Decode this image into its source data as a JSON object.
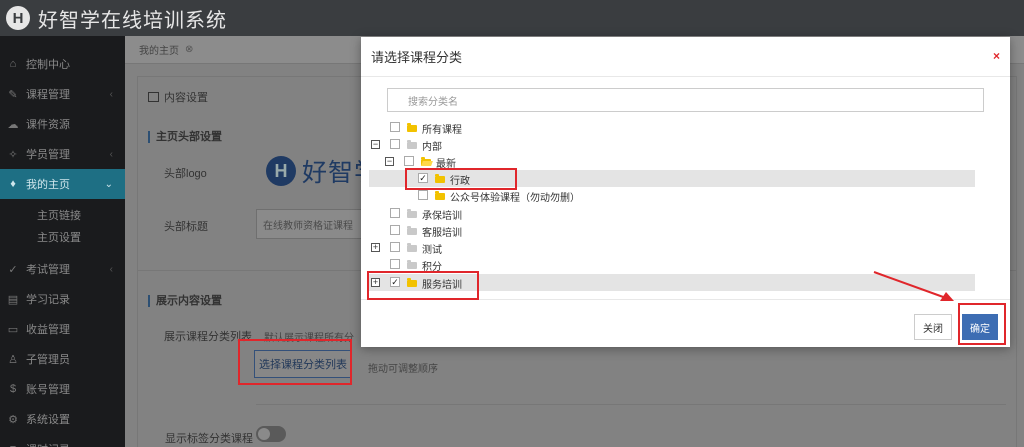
{
  "app": {
    "logo_letter": "H",
    "title": "好智学在线培训系统"
  },
  "sidebar": {
    "items": [
      {
        "icon": "home-icon",
        "glyph": "⌂",
        "label": "控制中心",
        "active": false,
        "chev": ""
      },
      {
        "icon": "course-icon",
        "glyph": "✎",
        "label": "课程管理",
        "active": false,
        "chev": "‹"
      },
      {
        "icon": "cloud-icon",
        "glyph": "☁",
        "label": "课件资源",
        "active": false,
        "chev": ""
      },
      {
        "icon": "student-icon",
        "glyph": "✧",
        "label": "学员管理",
        "active": false,
        "chev": "‹"
      },
      {
        "icon": "cap-icon",
        "glyph": "♦",
        "label": "我的主页",
        "active": true,
        "chev": "⌄"
      }
    ],
    "subitems": [
      "主页链接",
      "主页设置"
    ],
    "items2": [
      {
        "icon": "exam-icon",
        "glyph": "✓",
        "label": "考试管理",
        "chev": "‹"
      },
      {
        "icon": "record-icon",
        "glyph": "▤",
        "label": "学习记录",
        "chev": ""
      },
      {
        "icon": "income-icon",
        "glyph": "▭",
        "label": "收益管理",
        "chev": ""
      },
      {
        "icon": "admin-icon",
        "glyph": "♙",
        "label": "子管理员",
        "chev": ""
      },
      {
        "icon": "dollar-icon",
        "glyph": "$",
        "label": "账号管理",
        "chev": ""
      },
      {
        "icon": "gear-icon",
        "glyph": "⚙",
        "label": "系统设置",
        "chev": ""
      },
      {
        "icon": "log-icon",
        "glyph": "≡",
        "label": "课时记录",
        "chev": ""
      }
    ]
  },
  "main": {
    "tab_label": "我的主页",
    "tab_close": "⊗",
    "card_title": "内容设置",
    "section1_title": "主页头部设置",
    "logo_label": "头部logo",
    "logo_preview_letter": "H",
    "logo_preview_text": "好智学",
    "header_title_label": "头部标题",
    "header_title_value": "在线教师资格证课程",
    "section2_title": "展示内容设置",
    "show_list_label": "展示课程分类列表",
    "show_list_hint": "默认展示课程所有分",
    "select_button": "选择课程分类列表",
    "drag_hint": "拖动可调整顺序",
    "tag_label": "显示标签分类课程"
  },
  "modal": {
    "title": "请选择课程分类",
    "close_glyph": "×",
    "search_placeholder": "搜索分类名",
    "tree": [
      {
        "label": "所有课程",
        "level": 0,
        "expander": "",
        "checked": false,
        "folder": "yellow",
        "highlight": false
      },
      {
        "label": "内部",
        "level": 0,
        "expander": "−",
        "checked": false,
        "folder": "grey",
        "highlight": false
      },
      {
        "label": "最新",
        "level": 1,
        "expander": "−",
        "checked": false,
        "folder": "open",
        "highlight": false
      },
      {
        "label": "行政",
        "level": 2,
        "expander": "",
        "checked": true,
        "folder": "yellow",
        "highlight": true
      },
      {
        "label": "公众号体验课程（勿动勿删）",
        "level": 2,
        "expander": "",
        "checked": false,
        "folder": "yellow",
        "highlight": false
      },
      {
        "label": "承保培训",
        "level": 0,
        "expander": "",
        "checked": false,
        "folder": "grey",
        "highlight": false
      },
      {
        "label": "客服培训",
        "level": 0,
        "expander": "",
        "checked": false,
        "folder": "grey",
        "highlight": false
      },
      {
        "label": "测试",
        "level": 0,
        "expander": "+",
        "checked": false,
        "folder": "grey",
        "highlight": false
      },
      {
        "label": "积分",
        "level": 0,
        "expander": "",
        "checked": false,
        "folder": "grey",
        "highlight": false
      },
      {
        "label": "服务培训",
        "level": 0,
        "expander": "+",
        "checked": true,
        "folder": "yellow",
        "highlight": true
      }
    ],
    "close_button": "关闭",
    "ok_button": "确定"
  },
  "colors": {
    "accent": "#3d6db3",
    "annotation": "#e0262b",
    "sidebar_active": "#1e6f84"
  }
}
